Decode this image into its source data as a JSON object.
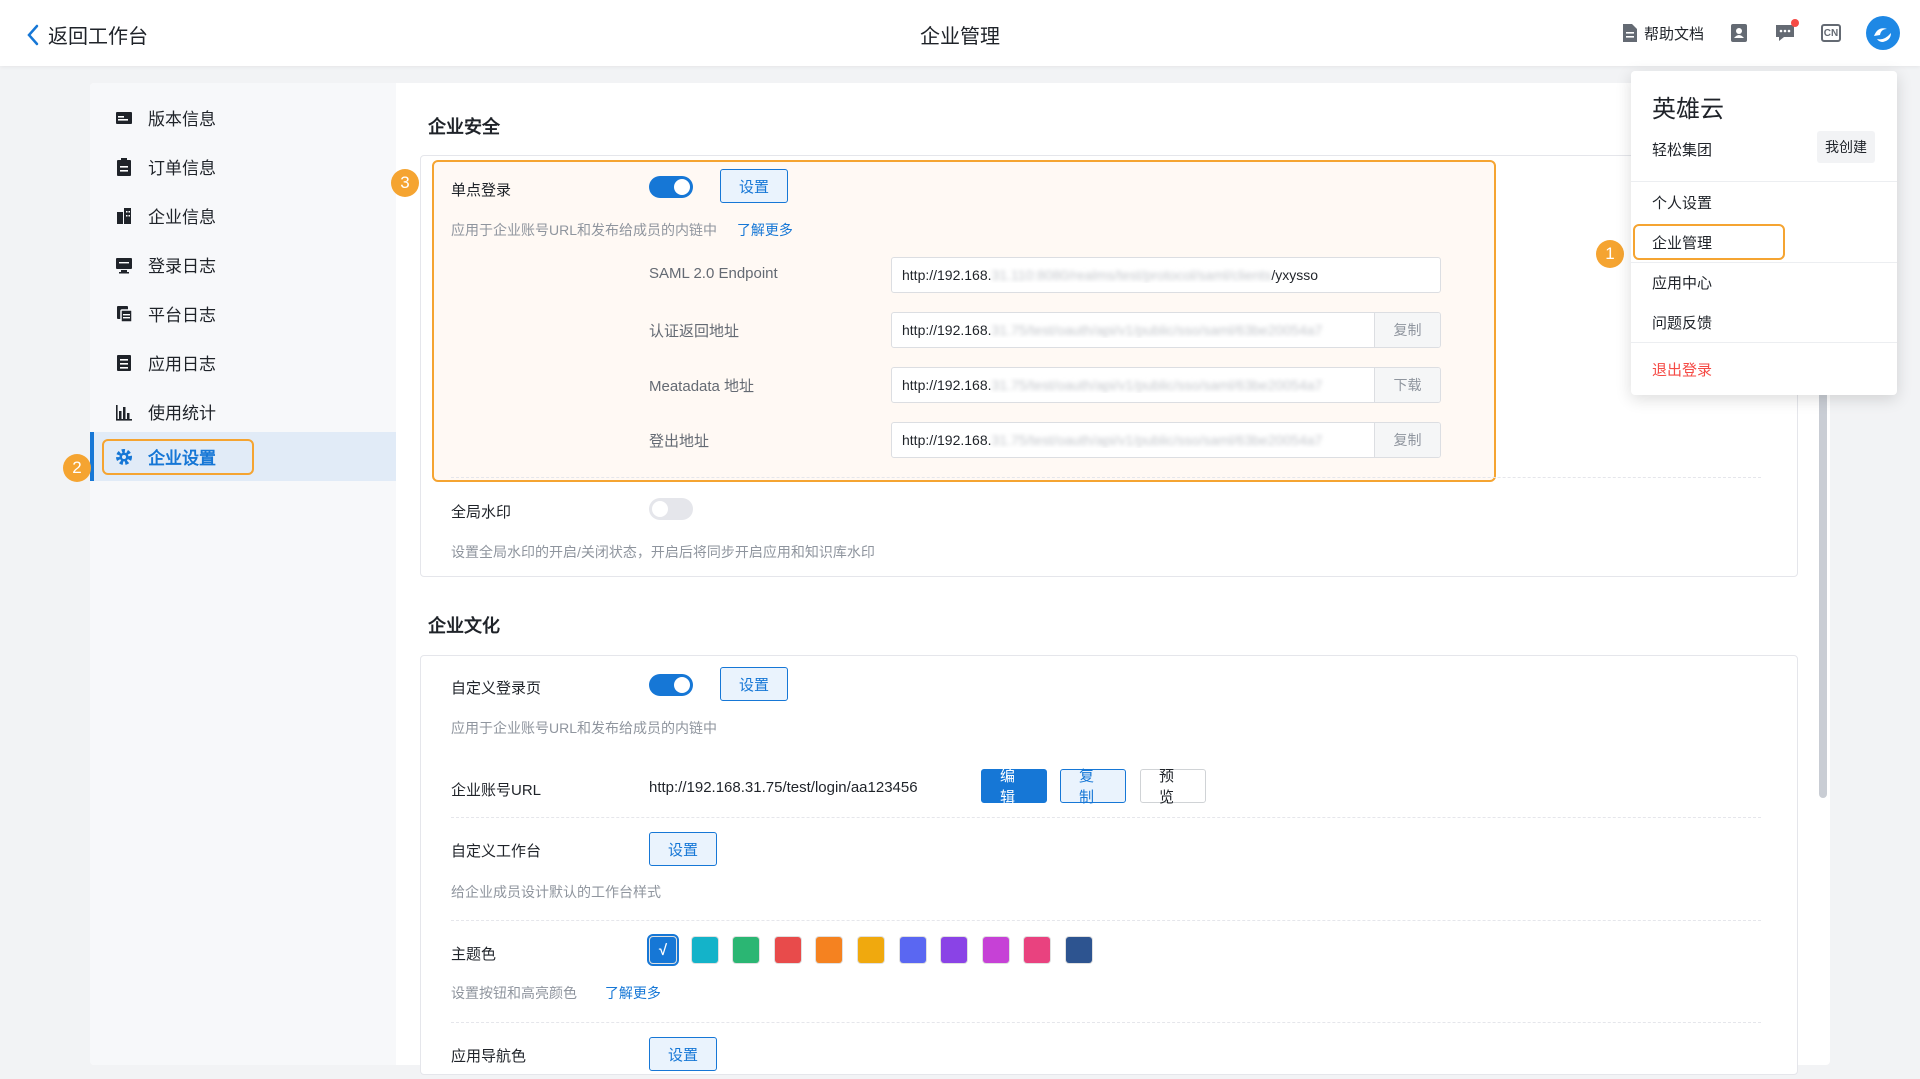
{
  "header": {
    "back_label": "返回工作台",
    "title": "企业管理",
    "help_label": "帮助文档",
    "lang_badge": "CN",
    "icons": [
      "doc-icon",
      "contacts-icon",
      "message-icon",
      "language-icon",
      "app-logo"
    ]
  },
  "sidebar": {
    "items": [
      {
        "label": "版本信息",
        "icon": "card-icon"
      },
      {
        "label": "订单信息",
        "icon": "clipboard-icon"
      },
      {
        "label": "企业信息",
        "icon": "building-icon"
      },
      {
        "label": "登录日志",
        "icon": "monitor-icon"
      },
      {
        "label": "平台日志",
        "icon": "file-copy-icon"
      },
      {
        "label": "应用日志",
        "icon": "list-icon"
      },
      {
        "label": "使用统计",
        "icon": "bar-chart-icon"
      },
      {
        "label": "企业设置",
        "icon": "gear-icon",
        "active": true
      }
    ]
  },
  "badges": {
    "b1": "1",
    "b2": "2",
    "b3": "3"
  },
  "security": {
    "title": "企业安全",
    "sso": {
      "label": "单点登录",
      "enabled": true,
      "settings_btn": "设置",
      "desc": "应用于企业账号URL和发布给成员的内链中",
      "learn_more": "了解更多",
      "fields": [
        {
          "label": "SAML 2.0 Endpoint",
          "prefix": "http://192.168.",
          "hidden": "31.110:8080/realms/test/protocol/saml/clients",
          "suffix_text": "/yxysso",
          "action": ""
        },
        {
          "label": "认证返回地址",
          "prefix": "http://192.168.",
          "hidden": "31.75/test/oauth/api/v1/public/sso/saml/63be20054a7",
          "suffix_text": "",
          "action": "复制"
        },
        {
          "label": "Meatadata 地址",
          "prefix": "http://192.168.",
          "hidden": "31.75/test/oauth/api/v1/public/sso/saml/63be20054a7",
          "suffix_text": "",
          "action": "下载"
        },
        {
          "label": "登出地址",
          "prefix": "http://192.168.",
          "hidden": "31.75/test/oauth/api/v1/public/sso/saml/63be20054a7",
          "suffix_text": "",
          "action": "复制"
        }
      ]
    },
    "watermark": {
      "label": "全局水印",
      "enabled": false,
      "desc": "设置全局水印的开启/关闭状态，开启后将同步开启应用和知识库水印"
    }
  },
  "culture": {
    "title": "企业文化",
    "login_page": {
      "label": "自定义登录页",
      "enabled": true,
      "settings_btn": "设置",
      "desc": "应用于企业账号URL和发布给成员的内链中"
    },
    "account_url": {
      "label": "企业账号URL",
      "value": "http://192.168.31.75/test/login/aa123456",
      "edit_btn": "编辑",
      "copy_btn": "复制",
      "preview_btn": "预览"
    },
    "workbench": {
      "label": "自定义工作台",
      "settings_btn": "设置",
      "desc": "给企业成员设计默认的工作台样式"
    },
    "theme": {
      "label": "主题色",
      "selected_mark": "√",
      "colors": [
        "#1677d6",
        "#14b3c9",
        "#2bb673",
        "#e84b4b",
        "#f58220",
        "#f0a90e",
        "#5a67f2",
        "#8a43e6",
        "#c641d6",
        "#e9427f",
        "#2d5490"
      ],
      "desc": "设置按钮和高亮颜色",
      "learn_more": "了解更多"
    },
    "nav_color": {
      "label": "应用导航色",
      "settings_btn": "设置"
    }
  },
  "dropdown": {
    "org_name": "英雄云",
    "group_name": "轻松集团",
    "group_tag": "我创建",
    "items": [
      "个人设置",
      "企业管理",
      "应用中心",
      "问题反馈"
    ],
    "logout": "退出登录"
  }
}
